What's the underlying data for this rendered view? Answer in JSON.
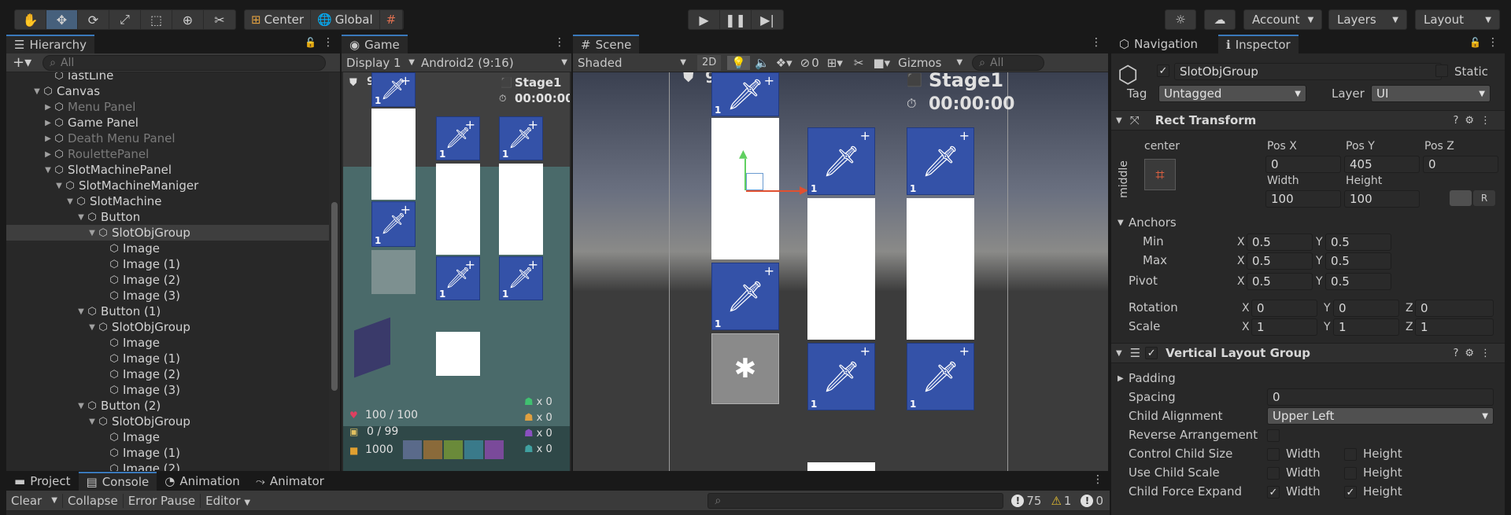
{
  "toolbar": {
    "tools": [
      "hand-tool",
      "move-tool",
      "rotate-tool",
      "scale-tool",
      "rect-tool",
      "transform-tool",
      "custom-tool"
    ],
    "pivot_mode": "Center",
    "pivot_rotation": "Global",
    "account": "Account",
    "layers": "Layers",
    "layout": "Layout"
  },
  "hierarchy": {
    "tab": "Hierarchy",
    "search_placeholder": "All",
    "rows": [
      {
        "label": "lastLine",
        "depth": 4,
        "arrow": "",
        "dim": false
      },
      {
        "label": "Canvas",
        "depth": 3,
        "arrow": "▼",
        "dim": false
      },
      {
        "label": "Menu Panel",
        "depth": 4,
        "arrow": "▶",
        "dim": true
      },
      {
        "label": "Game Panel",
        "depth": 4,
        "arrow": "▶",
        "dim": false
      },
      {
        "label": "Death Menu Panel",
        "depth": 4,
        "arrow": "▶",
        "dim": true
      },
      {
        "label": "RoulettePanel",
        "depth": 4,
        "arrow": "▶",
        "dim": true
      },
      {
        "label": "SlotMachinePanel",
        "depth": 4,
        "arrow": "▼",
        "dim": false
      },
      {
        "label": "SlotMachineManiger",
        "depth": 5,
        "arrow": "▼",
        "dim": false
      },
      {
        "label": "SlotMachine",
        "depth": 6,
        "arrow": "▼",
        "dim": false
      },
      {
        "label": "Button",
        "depth": 7,
        "arrow": "▼",
        "dim": false
      },
      {
        "label": "SlotObjGroup",
        "depth": 8,
        "arrow": "▼",
        "dim": false,
        "selected": true
      },
      {
        "label": "Image",
        "depth": 9,
        "arrow": "",
        "dim": false
      },
      {
        "label": "Image (1)",
        "depth": 9,
        "arrow": "",
        "dim": false
      },
      {
        "label": "Image (2)",
        "depth": 9,
        "arrow": "",
        "dim": false
      },
      {
        "label": "Image (3)",
        "depth": 9,
        "arrow": "",
        "dim": false
      },
      {
        "label": "Button (1)",
        "depth": 7,
        "arrow": "▼",
        "dim": false
      },
      {
        "label": "SlotObjGroup",
        "depth": 8,
        "arrow": "▼",
        "dim": false
      },
      {
        "label": "Image",
        "depth": 9,
        "arrow": "",
        "dim": false
      },
      {
        "label": "Image (1)",
        "depth": 9,
        "arrow": "",
        "dim": false
      },
      {
        "label": "Image (2)",
        "depth": 9,
        "arrow": "",
        "dim": false
      },
      {
        "label": "Image (3)",
        "depth": 9,
        "arrow": "",
        "dim": false
      },
      {
        "label": "Button (2)",
        "depth": 7,
        "arrow": "▼",
        "dim": false
      },
      {
        "label": "SlotObjGroup",
        "depth": 8,
        "arrow": "▼",
        "dim": false
      },
      {
        "label": "Image",
        "depth": 9,
        "arrow": "",
        "dim": false
      },
      {
        "label": "Image (1)",
        "depth": 9,
        "arrow": "",
        "dim": false
      },
      {
        "label": "Image (2)",
        "depth": 9,
        "arrow": "",
        "dim": false
      }
    ]
  },
  "game": {
    "tab": "Game",
    "display": "Display 1",
    "aspect": "Android2 (9:16)",
    "stage": "Stage1",
    "timer": "00:00:00",
    "level_number": "9",
    "hp": "100 / 100",
    "capacity": "0 / 99",
    "gold": "1000",
    "counters": [
      "x 0",
      "x 0",
      "x 0",
      "x 0"
    ],
    "card_number": "1"
  },
  "scene": {
    "tab": "Scene",
    "shading": "Shaded",
    "mode_2d": "2D",
    "hidden_count": "0",
    "gizmos": "Gizmos",
    "search_placeholder": "All",
    "stage": "Stage1",
    "timer": "00:00:00",
    "level_number": "9",
    "card_number": "1"
  },
  "inspector": {
    "tabs": [
      "Navigation",
      "Inspector"
    ],
    "object_name": "SlotObjGroup",
    "static_label": "Static",
    "tag_label": "Tag",
    "tag_value": "Untagged",
    "layer_label": "Layer",
    "layer_value": "UI",
    "rect_transform": {
      "title": "Rect Transform",
      "anchor_h": "center",
      "anchor_v": "middle",
      "pos_x_label": "Pos X",
      "pos_x": "0",
      "pos_y_label": "Pos Y",
      "pos_y": "405",
      "pos_z_label": "Pos Z",
      "pos_z": "0",
      "width_label": "Width",
      "width": "100",
      "height_label": "Height",
      "height": "100",
      "anchors_label": "Anchors",
      "min_label": "Min",
      "min_x": "0.5",
      "min_y": "0.5",
      "max_label": "Max",
      "max_x": "0.5",
      "max_y": "0.5",
      "pivot_label": "Pivot",
      "pivot_x": "0.5",
      "pivot_y": "0.5",
      "rotation_label": "Rotation",
      "rot_x": "0",
      "rot_y": "0",
      "rot_z": "0",
      "scale_label": "Scale",
      "scale_x": "1",
      "scale_y": "1",
      "scale_z": "1",
      "x": "X",
      "y": "Y",
      "z": "Z"
    },
    "vertical_layout": {
      "title": "Vertical Layout Group",
      "padding_label": "Padding",
      "spacing_label": "Spacing",
      "spacing": "0",
      "child_alignment_label": "Child Alignment",
      "child_alignment": "Upper Left",
      "reverse_label": "Reverse Arrangement",
      "control_size_label": "Control Child Size",
      "use_scale_label": "Use Child Scale",
      "force_expand_label": "Child Force Expand",
      "width_label": "Width",
      "height_label": "Height"
    }
  },
  "bottom": {
    "tabs": [
      "Project",
      "Console",
      "Animation",
      "Animator"
    ],
    "active_tab": "Console",
    "clear": "Clear",
    "collapse": "Collapse",
    "error_pause": "Error Pause",
    "editor": "Editor",
    "log_count": "75",
    "warn_count": "1",
    "error_count": "0"
  }
}
